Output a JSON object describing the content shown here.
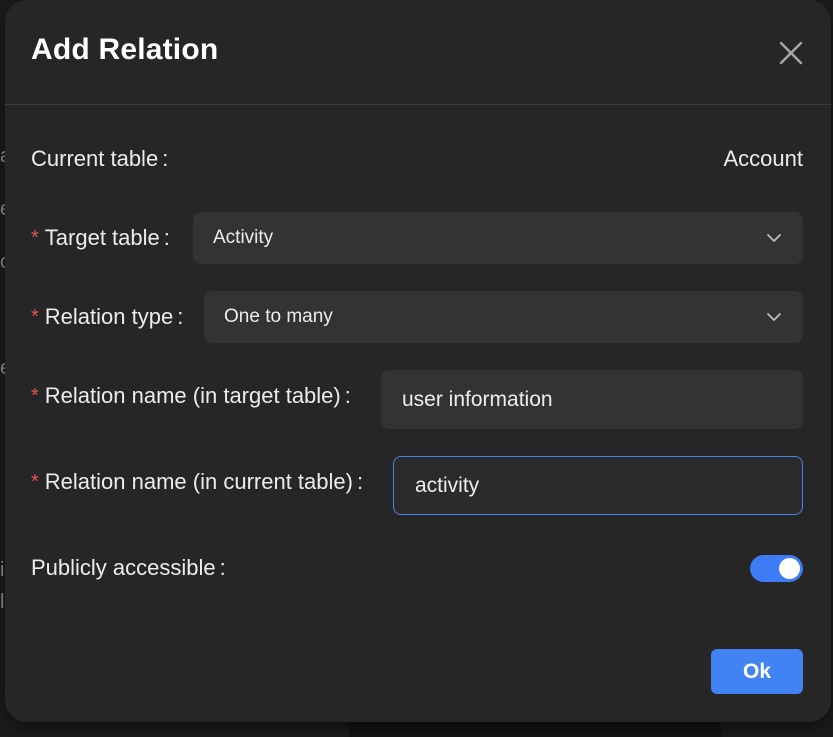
{
  "dialog": {
    "title": "Add Relation",
    "close_icon": "close-icon",
    "colon": ":",
    "required_mark": "*",
    "current_table": {
      "label": "Current table",
      "value": "Account"
    },
    "target_table": {
      "label": "Target table",
      "selected": "Activity",
      "icon": "chevron-down-icon"
    },
    "relation_type": {
      "label": "Relation type",
      "selected": "One to many",
      "icon": "chevron-down-icon"
    },
    "relation_name_target": {
      "label": "Relation name (in target table)",
      "value": "user information"
    },
    "relation_name_current": {
      "label": "Relation name (in current table)",
      "value": "activity"
    },
    "public_access": {
      "label": "Publicly accessible",
      "enabled": true
    },
    "ok_label": "Ok",
    "colors": {
      "accent": "#4183f3",
      "required": "#e05555",
      "surface": "#262626",
      "field": "#333333"
    }
  }
}
